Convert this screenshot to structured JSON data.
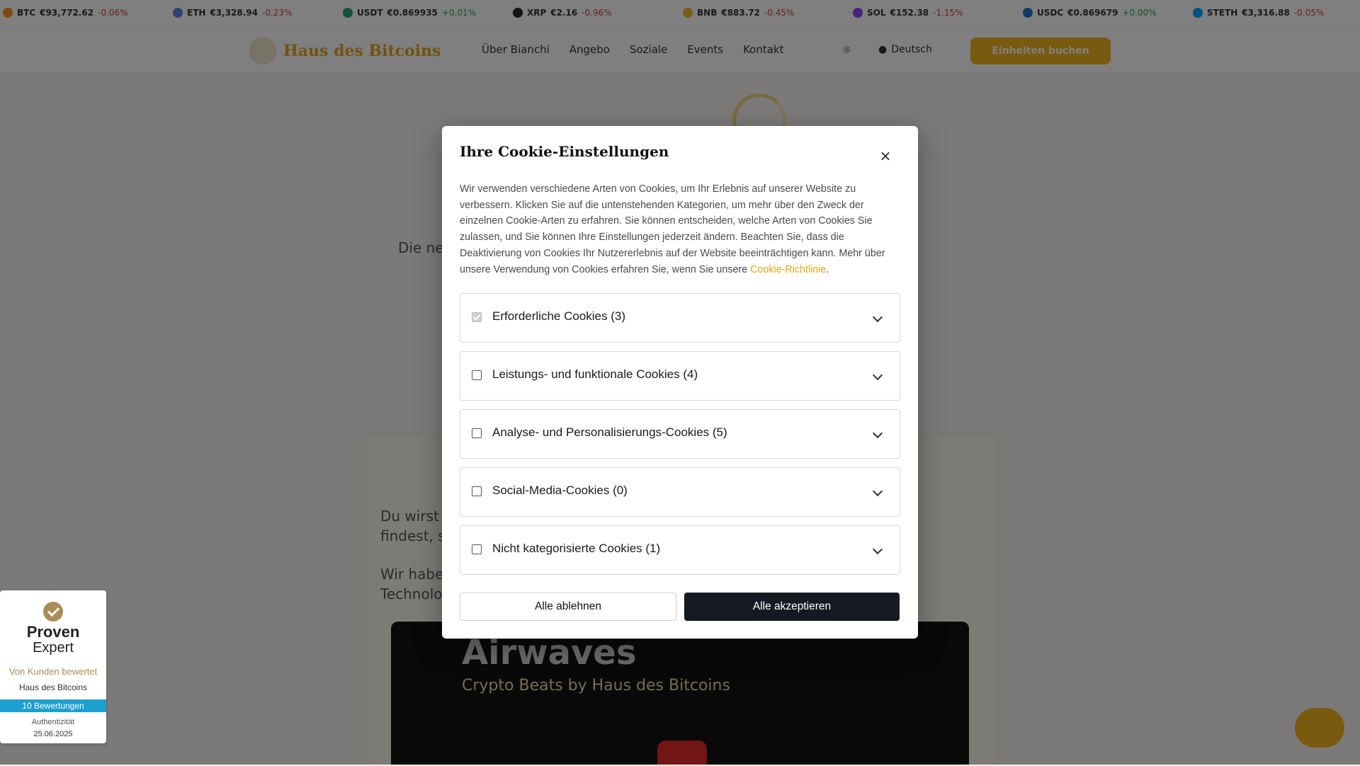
{
  "ticker": [
    {
      "symbol": "BTC",
      "price": "€93,772.62",
      "change": "-0.06%",
      "dir": "neg",
      "color": "#f7931a"
    },
    {
      "symbol": "ETH",
      "price": "€3,328.94",
      "change": "-0.23%",
      "dir": "neg",
      "color": "#627eea"
    },
    {
      "symbol": "USDT",
      "price": "€0.869935",
      "change": "+0.01%",
      "dir": "pos",
      "color": "#26a17b"
    },
    {
      "symbol": "XRP",
      "price": "€2.16",
      "change": "-0.96%",
      "dir": "neg",
      "color": "#23292f"
    },
    {
      "symbol": "BNB",
      "price": "€883.72",
      "change": "-0.45%",
      "dir": "neg",
      "color": "#f3ba2f"
    },
    {
      "symbol": "SOL",
      "price": "€152.38",
      "change": "-1.15%",
      "dir": "neg",
      "color": "#9945ff"
    },
    {
      "symbol": "USDC",
      "price": "€0.869679",
      "change": "+0.00%",
      "dir": "pos",
      "color": "#2775ca"
    },
    {
      "symbol": "STETH",
      "price": "€3,316.88",
      "change": "-0.05%",
      "dir": "neg",
      "color": "#00a3ff"
    }
  ],
  "header": {
    "logo_text": "Haus des Bitcoins",
    "nav": [
      "Über Bianchi",
      "Angebo",
      "Soziale",
      "Events",
      "Kontakt"
    ],
    "lang": "Deutsch",
    "cta": "Einheiten buchen"
  },
  "background": {
    "line1": "Die neu                                                                                           er, die",
    "card_p1": "Du wirst di                                                                                           , die du",
    "card_p2": "findest, so",
    "card_p3": "Wir haben",
    "card_p4": "Technologie",
    "video_title": "Airwaves",
    "video_sub": "Crypto Beats by Haus des Bitcoins"
  },
  "modal": {
    "title": "Ihre Cookie-Einstellungen",
    "close": "×",
    "description": "Wir verwenden verschiedene Arten von Cookies, um Ihr Erlebnis auf unserer Website zu verbessern. Klicken Sie auf die untenstehenden Kategorien, um mehr über den Zweck der einzelnen Cookie-Arten zu erfahren. Sie können entscheiden, welche Arten von Cookies Sie zulassen, und Sie können Ihre Einstellungen jederzeit ändern. Beachten Sie, dass die Deaktivierung von Cookies Ihr Nutzererlebnis auf der Website beeinträchtigen kann. Mehr über unsere Verwendung von Cookies erfahren Sie, wenn Sie unsere ",
    "policy_link": "Cookie-Richtlinie",
    "policy_suffix": ".",
    "categories": [
      {
        "label": "Erforderliche Cookies (3)",
        "checked": true
      },
      {
        "label": "Leistungs- und funktionale Cookies (4)",
        "checked": false
      },
      {
        "label": "Analyse- und Personalisierungs-Cookies (5)",
        "checked": false
      },
      {
        "label": "Social-Media-Cookies (0)",
        "checked": false
      },
      {
        "label": "Nicht kategorisierte Cookies (1)",
        "checked": false
      }
    ],
    "reject": "Alle ablehnen",
    "accept": "Alle akzeptieren"
  },
  "provenexpert": {
    "brand_line1": "Proven",
    "brand_line2": "Expert",
    "rated": "Von Kunden bewertet",
    "company": "Haus des Bitcoins",
    "reviews": "10 Bewertungen",
    "auth": "Authentizität",
    "date": "25.06.2025"
  }
}
